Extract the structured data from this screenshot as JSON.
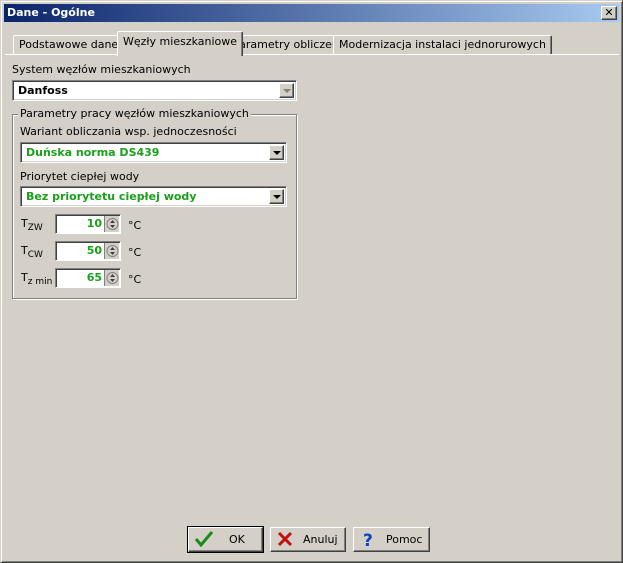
{
  "window": {
    "title": "Dane - Ogólne",
    "close_symbol": "✕"
  },
  "tabs": [
    {
      "label": "Podstawowe dane",
      "active": false
    },
    {
      "label": "Węzły mieszkaniowe",
      "active": true
    },
    {
      "label": "Parametry obliczeń",
      "active": false
    },
    {
      "label": "Modernizacja instalaci jednorurowych",
      "active": false
    }
  ],
  "system": {
    "label": "System węzłów mieszkaniowych",
    "value": "Danfoss"
  },
  "group": {
    "title": "Parametry pracy węzłów mieszkaniowych",
    "variant_label": "Wariant obliczania wsp. jednoczesności",
    "variant_value": "Duńska norma DS439",
    "priority_label": "Priorytet ciepłej wody",
    "priority_value": "Bez priorytetu ciepłej wody",
    "fields": [
      {
        "label_main": "T",
        "label_sub": "ZW",
        "value": "10",
        "unit": "°C"
      },
      {
        "label_main": "T",
        "label_sub": "CW",
        "value": "50",
        "unit": "°C"
      },
      {
        "label_main": "T",
        "label_sub": "z min",
        "value": "65",
        "unit": "°C"
      }
    ]
  },
  "buttons": {
    "ok": "OK",
    "cancel": "Anuluj",
    "help": "Pomoc"
  },
  "colors": {
    "value_green": "#1aa01a",
    "title_bar": "#0a246a"
  }
}
